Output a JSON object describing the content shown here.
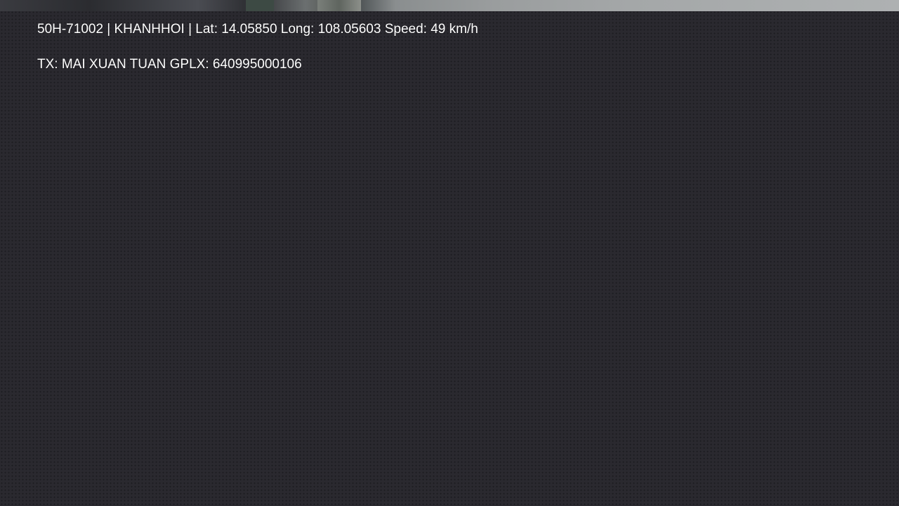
{
  "overlay": {
    "vehicle_info": "50H-71002 | KHANHHOI | Lat: 14.05850 Long: 108.05603 Speed: 49 km/h",
    "driver_info": "TX: MAI XUAN TUAN GPLX: 640995000106"
  },
  "colors": {
    "background": "#2a292f",
    "text": "#ffffff"
  }
}
